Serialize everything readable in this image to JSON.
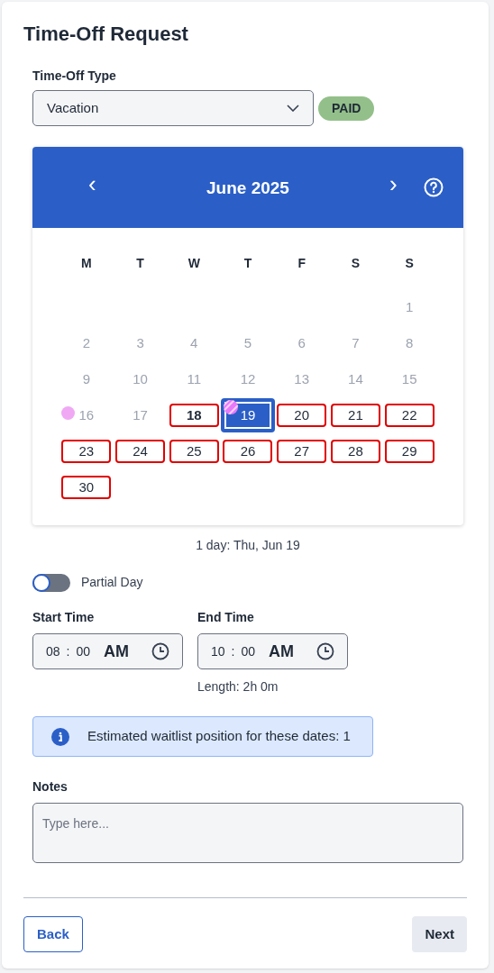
{
  "title": "Time-Off Request",
  "type_field": {
    "label": "Time-Off Type",
    "value": "Vacation",
    "badge": "PAID"
  },
  "calendar": {
    "month": "June 2025",
    "prev": "‹",
    "next": "›",
    "weekdays": [
      "M",
      "T",
      "W",
      "T",
      "F",
      "S",
      "S"
    ],
    "weeks": [
      {
        "right_aligned": true,
        "days": [
          {
            "day": "1",
            "kind": "past"
          }
        ]
      },
      {
        "days": [
          {
            "day": "2",
            "kind": "past"
          },
          {
            "day": "3",
            "kind": "past"
          },
          {
            "day": "4",
            "kind": "past"
          },
          {
            "day": "5",
            "kind": "past"
          },
          {
            "day": "6",
            "kind": "past"
          },
          {
            "day": "7",
            "kind": "past"
          },
          {
            "day": "8",
            "kind": "past"
          }
        ]
      },
      {
        "days": [
          {
            "day": "9",
            "kind": "past"
          },
          {
            "day": "10",
            "kind": "past"
          },
          {
            "day": "11",
            "kind": "past"
          },
          {
            "day": "12",
            "kind": "past"
          },
          {
            "day": "13",
            "kind": "past"
          },
          {
            "day": "14",
            "kind": "past"
          },
          {
            "day": "15",
            "kind": "past"
          }
        ]
      },
      {
        "days": [
          {
            "day": "16",
            "kind": "past",
            "event": true
          },
          {
            "day": "17",
            "kind": "past"
          },
          {
            "day": "18",
            "kind": "open",
            "today": true
          },
          {
            "day": "19",
            "kind": "open",
            "selected": true,
            "event": true,
            "striped": true
          },
          {
            "day": "20",
            "kind": "open"
          },
          {
            "day": "21",
            "kind": "open"
          },
          {
            "day": "22",
            "kind": "open"
          }
        ]
      },
      {
        "days": [
          {
            "day": "23",
            "kind": "open"
          },
          {
            "day": "24",
            "kind": "open"
          },
          {
            "day": "25",
            "kind": "open"
          },
          {
            "day": "26",
            "kind": "open"
          },
          {
            "day": "27",
            "kind": "open"
          },
          {
            "day": "28",
            "kind": "open"
          },
          {
            "day": "29",
            "kind": "open"
          }
        ]
      },
      {
        "days": [
          {
            "day": "30",
            "kind": "open"
          }
        ]
      }
    ],
    "summary": "1 day: Thu, Jun 19"
  },
  "partial_day": {
    "label": "Partial Day",
    "on": false
  },
  "times": [
    {
      "label": "Start Time",
      "hour": "08",
      "separator": ":",
      "minute": "00",
      "period": "AM"
    },
    {
      "label": "End Time",
      "hour": "10",
      "separator": ":",
      "minute": "00",
      "period": "AM",
      "note": "Length: 2h 0m"
    }
  ],
  "info": "Estimated waitlist position for these dates: 1",
  "notes": {
    "label": "Notes",
    "placeholder": "Type here..."
  },
  "buttons": {
    "back": "Back",
    "next": "Next"
  }
}
